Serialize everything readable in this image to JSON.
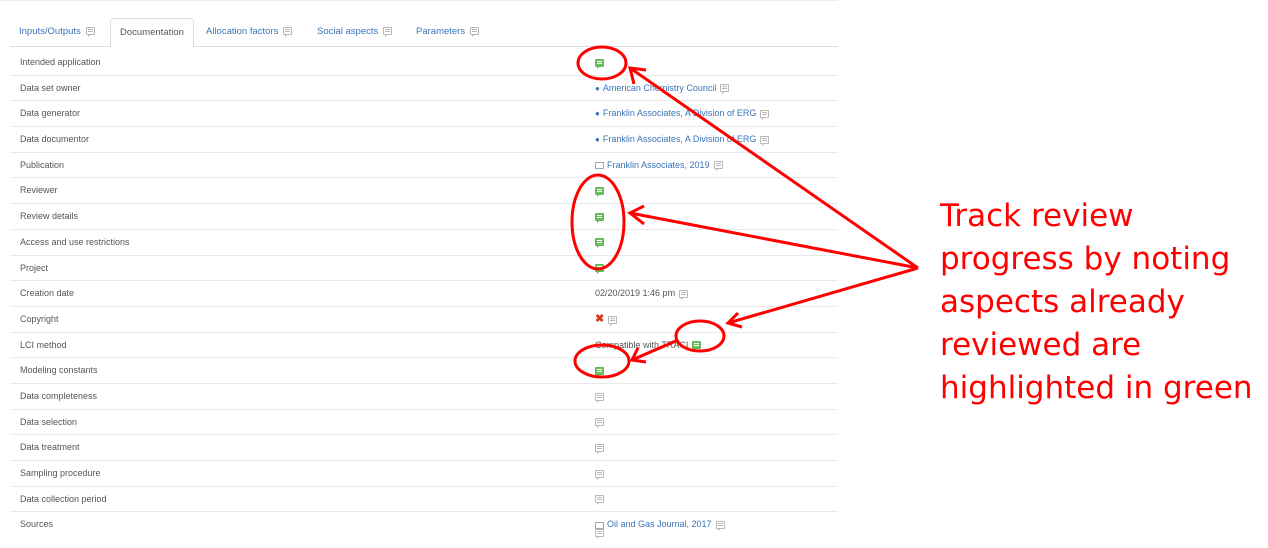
{
  "tabs": [
    {
      "label": "Inputs/Outputs"
    },
    {
      "label": "Documentation"
    },
    {
      "label": "Allocation factors"
    },
    {
      "label": "Social aspects"
    },
    {
      "label": "Parameters"
    }
  ],
  "rows": [
    {
      "label": "Intended application",
      "value": "",
      "comment_icon": "green"
    },
    {
      "label": "Data set owner",
      "value": "American Chemistry Council",
      "icon": "person-icon",
      "comment_icon": "grey"
    },
    {
      "label": "Data generator",
      "value": "Franklin Associates, A Division of ERG",
      "icon": "person-icon",
      "comment_icon": "grey"
    },
    {
      "label": "Data documentor",
      "value": "Franklin Associates, A Division of ERG",
      "icon": "person-icon",
      "comment_icon": "grey"
    },
    {
      "label": "Publication",
      "value": "Franklin Associates, 2019",
      "icon": "book-icon",
      "comment_icon": "grey"
    },
    {
      "label": "Reviewer",
      "value": "",
      "comment_icon": "green"
    },
    {
      "label": "Review details",
      "value": "",
      "comment_icon": "green"
    },
    {
      "label": "Access and use restrictions",
      "value": "",
      "comment_icon": "green"
    },
    {
      "label": "Project",
      "value": "",
      "comment_icon": "green"
    },
    {
      "label": "Creation date",
      "value": "02/20/2019 1:46 pm",
      "comment_icon": "grey"
    },
    {
      "label": "Copyright",
      "value": "",
      "icon": "x-icon",
      "comment_icon": "grey"
    },
    {
      "label": "LCI method",
      "value": "Compatible with TRACI",
      "comment_icon": "green"
    },
    {
      "label": "Modeling constants",
      "value": "",
      "comment_icon": "green"
    },
    {
      "label": "Data completeness",
      "value": "",
      "comment_icon": "grey"
    },
    {
      "label": "Data selection",
      "value": "",
      "comment_icon": "grey"
    },
    {
      "label": "Data treatment",
      "value": "",
      "comment_icon": "grey"
    },
    {
      "label": "Sampling procedure",
      "value": "",
      "comment_icon": "grey"
    },
    {
      "label": "Data collection period",
      "value": "",
      "comment_icon": "grey"
    },
    {
      "label": "Sources",
      "value": "Oil and Gas Journal, 2017",
      "icon": "book-icon",
      "comment_icon": "grey"
    }
  ],
  "annotation": {
    "lines": [
      "Track review",
      "progress by noting",
      "aspects already",
      "reviewed are",
      "highlighted in green"
    ],
    "color": "#ff0000"
  },
  "colors": {
    "link": "#3a75b8",
    "reviewed": "#6fbf5f",
    "annotation": "#ff0000"
  }
}
